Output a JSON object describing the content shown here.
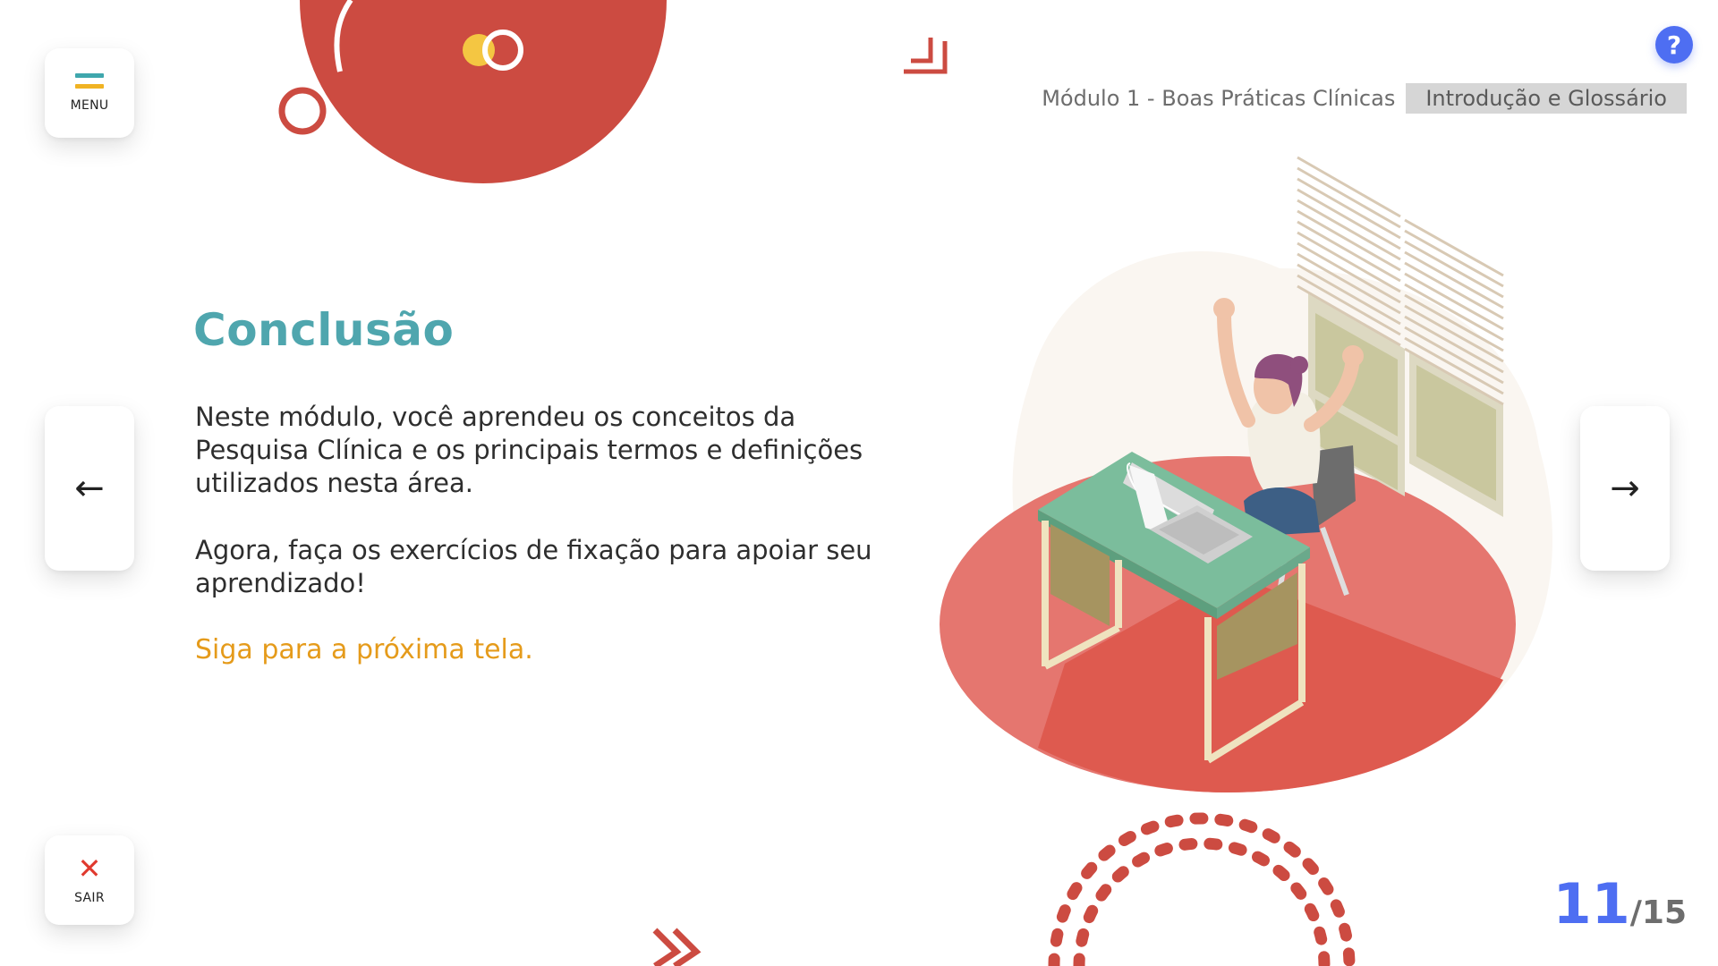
{
  "menu": {
    "label": "MENU"
  },
  "exit": {
    "label": "SAIR"
  },
  "help": {
    "label": "?"
  },
  "nav": {
    "prev_arrow": "←",
    "next_arrow": "→"
  },
  "breadcrumb": {
    "module": "Módulo 1 - Boas Práticas Clínicas",
    "section": "Introdução e Glossário"
  },
  "content": {
    "title": "Conclusão",
    "paragraph1": "Neste módulo, você aprendeu os conceitos da Pesquisa Clínica e os principais termos e definições utilizados nesta área.",
    "paragraph2": "Agora, faça os exercícios de fixação para apoiar seu aprendizado!",
    "call_to_action": "Siga para a próxima tela."
  },
  "pagination": {
    "current": "11",
    "total": "/15"
  },
  "colors": {
    "title": "#4fa6ae",
    "accent_orange": "#e59b1b",
    "accent_blue": "#4e6ef2",
    "decor_red": "#cc4b41",
    "menu_bar_teal": "#3fa7ad",
    "menu_bar_yellow": "#f0b323",
    "exit_red": "#e03a2f"
  }
}
